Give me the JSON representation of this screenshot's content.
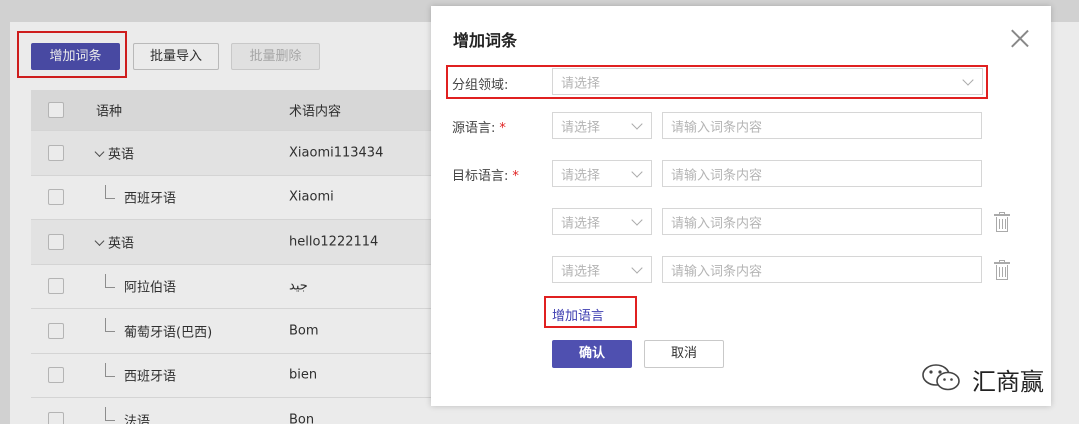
{
  "toolbar": {
    "add_entry_label": "增加词条",
    "import_label": "批量导入",
    "bulk_delete_label": "批量删除"
  },
  "table": {
    "headers": {
      "language": "语种",
      "term": "术语内容"
    },
    "rows": [
      {
        "language": "英语",
        "term": "Xiaomi113434",
        "level": "parent"
      },
      {
        "language": "西班牙语",
        "term": "Xiaomi",
        "level": "child"
      },
      {
        "language": "英语",
        "term": "hello1222114",
        "level": "parent"
      },
      {
        "language": "阿拉伯语",
        "term": "جيد",
        "level": "child"
      },
      {
        "language": "葡萄牙语(巴西)",
        "term": "Bom",
        "level": "child"
      },
      {
        "language": "西班牙语",
        "term": "bien",
        "level": "child"
      },
      {
        "language": "法语",
        "term": "Bon",
        "level": "child"
      }
    ]
  },
  "dialog": {
    "title": "增加词条",
    "group_label": "分组领域:",
    "group_placeholder": "请选择",
    "source_label": "源语言:",
    "target_label": "目标语言:",
    "required_mark": "*",
    "select_placeholder": "请选择",
    "input_placeholder": "请输入词条内容",
    "add_language_label": "增加语言",
    "confirm_label": "确认",
    "cancel_label": "取消"
  },
  "watermark": {
    "text": "汇商赢",
    "icon": "wechat-icon"
  },
  "colors": {
    "primary": "#4f50b0",
    "highlight": "#e02020",
    "link": "#3c3cb0"
  }
}
